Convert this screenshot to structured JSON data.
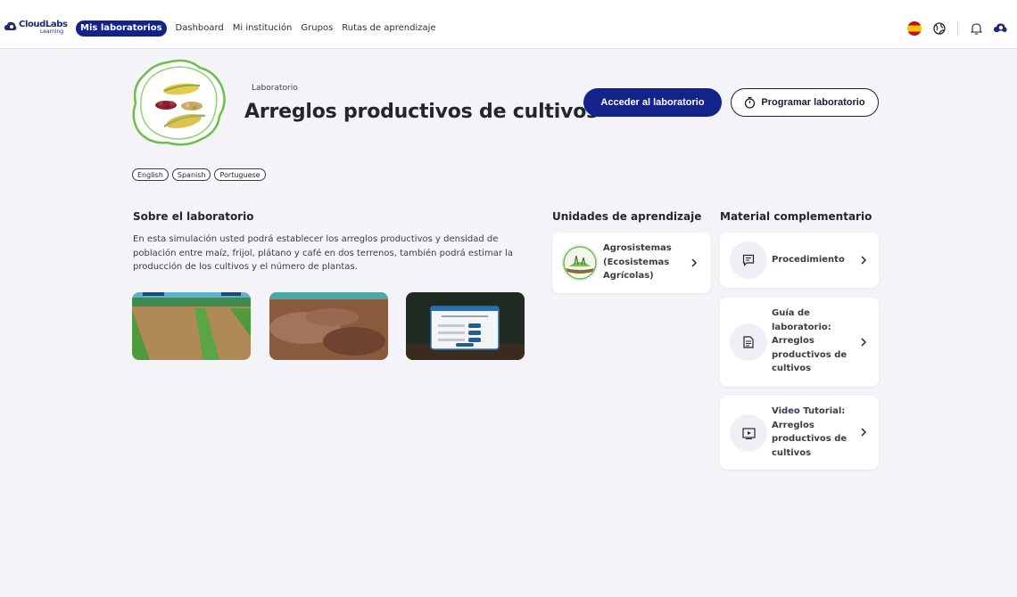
{
  "header": {
    "brand": "CloudLabs",
    "brand_sub": "Learning",
    "nav": [
      {
        "label": "Mis laboratorios",
        "active": true
      },
      {
        "label": "Dashboard",
        "active": false
      },
      {
        "label": "Mi institución",
        "active": false
      },
      {
        "label": "Grupos",
        "active": false
      },
      {
        "label": "Rutas de aprendizaje",
        "active": false
      }
    ],
    "icons": [
      "spain-flag-icon",
      "globe-icon",
      "bell-icon",
      "user-icon"
    ]
  },
  "lab": {
    "eyebrow": "Laboratorio",
    "title": "Arreglos productivos de cultivos",
    "primary_button": "Acceder al laboratorio",
    "secondary_button": "Programar laboratorio",
    "languages": [
      "English",
      "Spanish",
      "Portuguese"
    ]
  },
  "about": {
    "title": "Sobre el laboratorio",
    "description": "En esta simulación usted podrá establecer los arreglos productivos y densidad de población entre maíz, frijol, plátano y café en dos terrenos, también podrá estimar la producción de los cultivos y el número de plantas."
  },
  "units": {
    "title": "Unidades de aprendizaje",
    "items": [
      {
        "label": "Agrosistemas (Ecosistemas Agrícolas)"
      }
    ]
  },
  "materials": {
    "title": "Material complementario",
    "items": [
      {
        "label": "Procedimiento",
        "icon": "chat-icon"
      },
      {
        "label": "Guía de laboratorio: Arreglos productivos de cultivos",
        "icon": "document-icon"
      },
      {
        "label": "Video Tutorial: Arreglos productivos de cultivos",
        "icon": "video-icon"
      }
    ]
  },
  "colors": {
    "primary": "#14238a",
    "background": "#f4f3f8",
    "accent_green": "#6cc04a"
  }
}
